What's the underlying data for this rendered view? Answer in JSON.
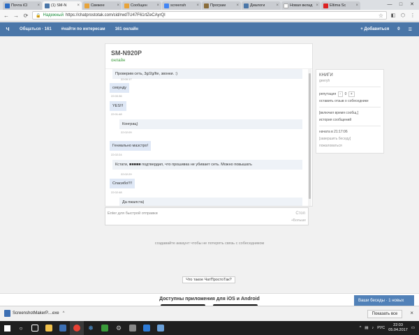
{
  "browser": {
    "tabs": [
      {
        "title": "Почта iCl",
        "fav": "#2b6cc4",
        "active": false
      },
      {
        "title": "(1) SM-N",
        "fav": "#4a76a8",
        "active": true
      },
      {
        "title": "Свежее",
        "fav": "#e7a33a",
        "active": false
      },
      {
        "title": "Сообщен",
        "fav": "#e7a33a",
        "active": false
      },
      {
        "title": "screensh",
        "fav": "#4285f4",
        "active": false
      },
      {
        "title": "Програм",
        "fav": "#8a6d3b",
        "active": false
      },
      {
        "title": "Диалоги",
        "fav": "#4a76a8",
        "active": false
      },
      {
        "title": "Новая вклад",
        "fav": "#ffffff",
        "active": false
      },
      {
        "title": "Eltima Sc",
        "fav": "#d22",
        "active": false
      }
    ],
    "secure_label": "Надежный",
    "url": "https://chatprostotak.com/cid/rwdTU47F61rtZeCAyrQl"
  },
  "header": {
    "logo": "Ч",
    "nav_chat": "Общаться · 161",
    "nav_find": "#найти по интересам",
    "online": "161 онлайн",
    "add": "+ Добавиться",
    "count": "0"
  },
  "chat": {
    "device": "SM-N920P",
    "status": "онлайн",
    "messages": [
      {
        "text": "Проверим сеть, 3g/2g/lte, звонки. :)",
        "time": "22:00:17",
        "own": false
      },
      {
        "text": "секунду",
        "time": "22:00:36",
        "own": true
      },
      {
        "text": "YES!!!",
        "time": "22:01:48",
        "own": true
      },
      {
        "text": "Конграц)",
        "time": "22:02:09",
        "own": false
      },
      {
        "text": "Гениально маэстро!",
        "time": "22:02:24",
        "own": true
      },
      {
        "text": "Кстати, ■■■■■ подтвердил, что прошивка не убивает сеть. Можно повышать",
        "time": "22:02:29",
        "own": false
      },
      {
        "text": "Спасибо!!!!",
        "time": "22:02:48",
        "own": true
      },
      {
        "text": "Да пжалста)",
        "time": "",
        "own": false
      }
    ]
  },
  "sidebar": {
    "title": "КНИГИ",
    "subtitle": "geeryh",
    "rep_label": "репутация",
    "rep_minus": "-",
    "rep_value": "0",
    "rep_plus": "+",
    "feedback": "оставить отзыв о собеседнике",
    "block": "[включил время сообщ.]",
    "history": "история сообщений",
    "started": "начата в 21:17:06",
    "end": "[завершить беседу]",
    "report": "пожаловаться"
  },
  "input": {
    "placeholder": "Enter для быстрой отправки",
    "stop": "Стоп",
    "more": "+Больше"
  },
  "hint": "создавайте аккаунт чтобы не потерять связь с собеседником",
  "what_btn": "Что такое ЧатПростоТак?",
  "promo": "Доступны приложения для iOS и Android",
  "conversations": "Ваши беседы · 1 новых",
  "download": {
    "file": "ScreenshotMakerP....exe",
    "show_all": "Показать все"
  },
  "taskbar": {
    "lang": "РУС",
    "time": "22:03",
    "date": "05.04.2017"
  }
}
